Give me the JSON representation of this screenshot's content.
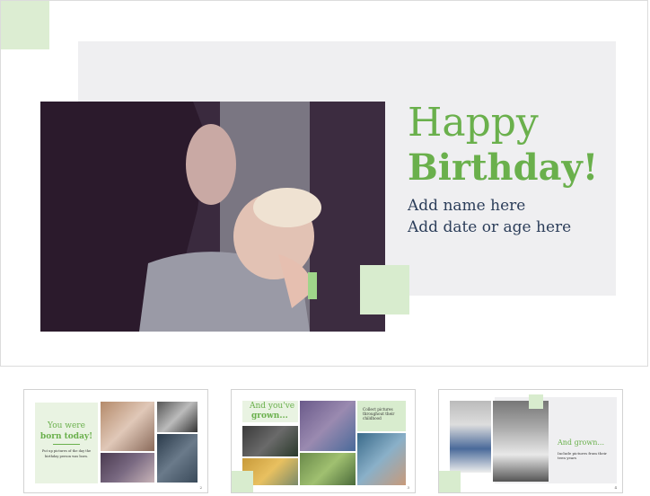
{
  "main_slide": {
    "title_line1": "Happy",
    "title_line2": "Birthday!",
    "subtitle_line1": "Add name here",
    "subtitle_line2": "Add date or age here"
  },
  "thumbnails": [
    {
      "heading_line1": "You were",
      "heading_line2": "born today!",
      "body": "Put up pictures of the day the",
      "body_line2": "birthday person was born.",
      "page": "2"
    },
    {
      "heading_line1": "And you've",
      "heading_line2": "grown...",
      "caption": "Collect pictures throughout their childhood",
      "page": "3"
    },
    {
      "heading": "And grown...",
      "body": "Include pictures from their teen years",
      "page": "4"
    }
  ],
  "colors": {
    "accent_green": "#6ab04c",
    "light_green": "#d8ecce",
    "panel_gray": "#efeff1",
    "text_navy": "#2c3e5a"
  }
}
